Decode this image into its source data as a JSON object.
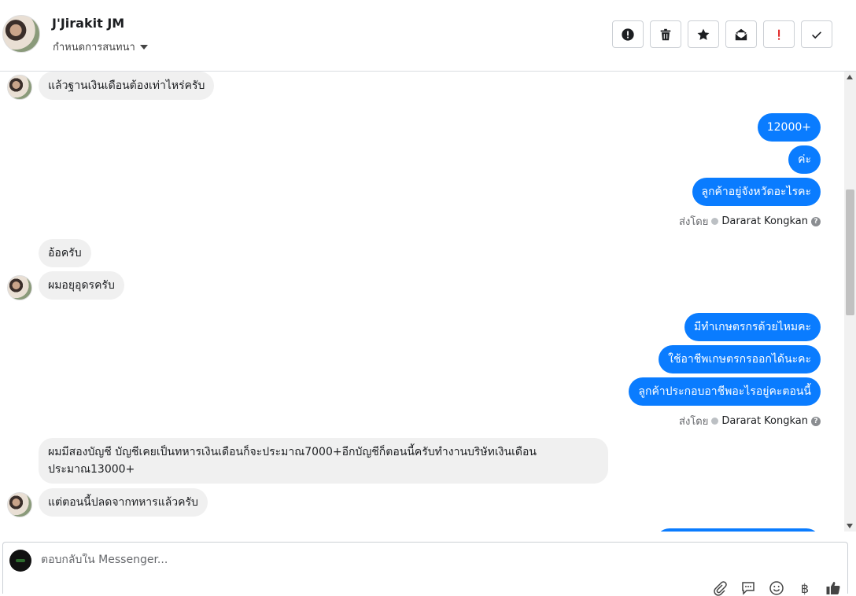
{
  "header": {
    "contact_name": "J'Jirakit JM",
    "conversation_settings": "กำหนดการสนทนา",
    "toolbar": [
      {
        "name": "report-icon",
        "label": "!"
      },
      {
        "name": "trash-icon",
        "label": ""
      },
      {
        "name": "star-icon",
        "label": ""
      },
      {
        "name": "mark-unread-icon",
        "label": ""
      },
      {
        "name": "spam-icon",
        "label": "!"
      },
      {
        "name": "done-icon",
        "label": ""
      }
    ]
  },
  "messages": [
    {
      "id": "m1",
      "side": "in",
      "text": "แล้วฐานเงินเดือนต้องเท่าไหร่ครับ"
    },
    {
      "id": "m2",
      "side": "out",
      "text": "12000+"
    },
    {
      "id": "m3",
      "side": "out",
      "text": "ค่ะ"
    },
    {
      "id": "m4",
      "side": "out",
      "text": "ลูกค้าอยู่จังหวัดอะไรคะ"
    },
    {
      "id": "m5",
      "side": "in",
      "text": "อ้อครับ"
    },
    {
      "id": "m6",
      "side": "in",
      "text": "ผมอยุอุดรครับ"
    },
    {
      "id": "m7",
      "side": "out",
      "text": "มีทำเกษตรกรด้วยไหมคะ"
    },
    {
      "id": "m8",
      "side": "out",
      "text": "ใช้อาชีพเกษตรกรออกได้นะคะ"
    },
    {
      "id": "m9",
      "side": "out",
      "text": "ลูกค้าประกอบอาชีพอะไรอยู่คะตอนนี้"
    },
    {
      "id": "m10",
      "side": "in",
      "text_line1": "ผมมีสองบัญชี บัญชีเคยเป็นทหารเงินเดือนก็จะประมาณ7000+อีกบัญชีก็ตอนนี้ครับทำงานบริษัทเงินเดือน",
      "text_line2": "ประมาณ13000+"
    },
    {
      "id": "m11",
      "side": "in",
      "text": "แต่ตอนนี้ปลดจากทหารแล้วครับ"
    }
  ],
  "sent_by": {
    "prefix": "ส่งโดย",
    "agent": "Dararat Kongkan",
    "help": "?"
  },
  "composer": {
    "placeholder": "ตอบกลับใน Messenger...",
    "icons": [
      "attachment-icon",
      "saved-replies-icon",
      "emoji-icon",
      "baht-icon",
      "like-icon"
    ],
    "baht_symbol": "฿"
  },
  "colors": {
    "outgoing_bubble": "#0a7cff",
    "incoming_bubble": "#f0f0f0"
  }
}
